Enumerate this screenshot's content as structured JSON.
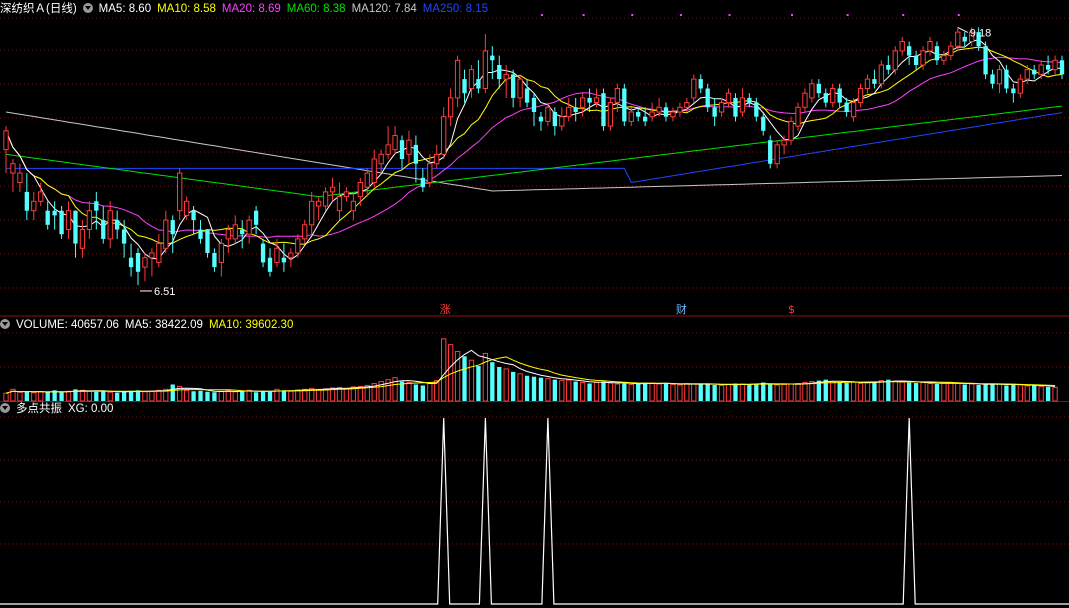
{
  "colors": {
    "up": "#ff3b3b",
    "down": "#54ffff",
    "ma5": "#ffffff",
    "ma10": "#ffff00",
    "ma20": "#ff40ff",
    "ma60": "#00e000",
    "ma120": "#c8c8c8",
    "ma250": "#2244ff",
    "grid": "#7a1010",
    "volma5": "#ffffff",
    "volma10": "#ffff00",
    "xg": "#ffffff"
  },
  "price_header": {
    "title": "深纺织Ａ(日线)",
    "ma5": "MA5: 8.60",
    "ma10": "MA10: 8.58",
    "ma20": "MA20: 8.69",
    "ma60": "MA60: 8.38",
    "ma120": "MA120: 7.84",
    "ma250": "MA250: 8.15"
  },
  "volume_header": {
    "label": "VOLUME: 40657.06",
    "ma5": "MA5: 38422.09",
    "ma10": "MA10: 39602.30"
  },
  "indicator_header": {
    "label": "多点共振",
    "xg": "XG: 0.00"
  },
  "annotations": {
    "high": "9.18",
    "low": "6.51",
    "zhang": "涨",
    "cai": "财",
    "dollar": "$"
  },
  "chart_data": {
    "type": "candlestick",
    "ylim": [
      6.35,
      9.35
    ],
    "volume_ylim": [
      0,
      70000
    ],
    "candles": [
      [
        7.95,
        8.15,
        8.2,
        7.7
      ],
      [
        7.7,
        7.8,
        7.85,
        7.5
      ],
      [
        7.6,
        7.7,
        7.8,
        7.5
      ],
      [
        7.5,
        7.3,
        7.7,
        7.2
      ],
      [
        7.3,
        7.4,
        7.5,
        7.2
      ],
      [
        7.4,
        7.5,
        7.6,
        7.35
      ],
      [
        7.3,
        7.15,
        7.4,
        7.1
      ],
      [
        7.3,
        7.25,
        7.4,
        7.1
      ],
      [
        7.3,
        7.05,
        7.35,
        7.0
      ],
      [
        7.1,
        7.3,
        7.4,
        7.0
      ],
      [
        7.3,
        6.95,
        7.3,
        6.8
      ],
      [
        6.9,
        7.1,
        7.2,
        6.8
      ],
      [
        7.1,
        7.3,
        7.4,
        7.0
      ],
      [
        7.4,
        7.3,
        7.5,
        7.1
      ],
      [
        7.2,
        7.0,
        7.35,
        6.95
      ],
      [
        7.0,
        7.3,
        7.4,
        6.9
      ],
      [
        7.2,
        7.1,
        7.3,
        7.0
      ],
      [
        7.1,
        6.95,
        7.2,
        6.8
      ],
      [
        6.8,
        6.7,
        6.95,
        6.6
      ],
      [
        6.85,
        6.65,
        6.9,
        6.51
      ],
      [
        6.7,
        6.8,
        6.85,
        6.55
      ],
      [
        6.8,
        6.85,
        6.9,
        6.6
      ],
      [
        6.75,
        6.95,
        7.05,
        6.7
      ],
      [
        6.9,
        7.2,
        7.3,
        6.85
      ],
      [
        7.2,
        7.05,
        7.25,
        6.85
      ],
      [
        7.3,
        7.7,
        7.75,
        7.2
      ],
      [
        7.25,
        7.4,
        7.45,
        7.2
      ],
      [
        7.3,
        7.2,
        7.35,
        7.05
      ],
      [
        7.1,
        7.0,
        7.2,
        6.95
      ],
      [
        7.1,
        6.85,
        7.1,
        6.8
      ],
      [
        6.85,
        6.7,
        6.9,
        6.65
      ],
      [
        6.75,
        6.95,
        7.0,
        6.6
      ],
      [
        7.0,
        7.1,
        7.15,
        6.85
      ],
      [
        7.0,
        7.15,
        7.25,
        6.95
      ],
      [
        7.1,
        7.05,
        7.2,
        6.9
      ],
      [
        7.05,
        7.2,
        7.25,
        6.95
      ],
      [
        7.3,
        7.15,
        7.35,
        7.05
      ],
      [
        6.95,
        6.75,
        7.0,
        6.7
      ],
      [
        6.8,
        6.65,
        6.9,
        6.6
      ],
      [
        6.75,
        6.9,
        7.0,
        6.7
      ],
      [
        6.8,
        6.75,
        6.95,
        6.65
      ],
      [
        6.8,
        6.85,
        6.9,
        6.7
      ],
      [
        6.85,
        7.0,
        7.05,
        6.8
      ],
      [
        7.0,
        7.15,
        7.2,
        6.95
      ],
      [
        7.15,
        7.4,
        7.5,
        7.05
      ],
      [
        7.35,
        7.4,
        7.45,
        7.2
      ],
      [
        7.35,
        7.5,
        7.55,
        7.3
      ],
      [
        7.5,
        7.55,
        7.65,
        7.4
      ],
      [
        7.3,
        7.45,
        7.6,
        7.2
      ],
      [
        7.45,
        7.5,
        7.55,
        7.4
      ],
      [
        7.3,
        7.4,
        7.5,
        7.2
      ],
      [
        7.45,
        7.6,
        7.65,
        7.35
      ],
      [
        7.55,
        7.7,
        7.75,
        7.45
      ],
      [
        7.6,
        7.85,
        7.95,
        7.55
      ],
      [
        7.8,
        7.9,
        7.95,
        7.7
      ],
      [
        7.9,
        8.0,
        8.2,
        7.85
      ],
      [
        7.95,
        8.1,
        8.2,
        7.9
      ],
      [
        8.05,
        7.85,
        8.1,
        7.75
      ],
      [
        7.9,
        8.05,
        8.15,
        7.8
      ],
      [
        8.0,
        7.8,
        8.1,
        7.6
      ],
      [
        7.65,
        7.55,
        7.75,
        7.5
      ],
      [
        7.6,
        7.8,
        7.9,
        7.55
      ],
      [
        7.8,
        7.9,
        8.0,
        7.75
      ],
      [
        7.9,
        8.3,
        8.4,
        7.85
      ],
      [
        8.3,
        8.5,
        8.6,
        8.2
      ],
      [
        8.5,
        8.9,
        8.95,
        8.4
      ],
      [
        8.7,
        8.55,
        8.8,
        8.45
      ],
      [
        8.6,
        8.8,
        8.85,
        8.5
      ],
      [
        8.7,
        8.6,
        8.9,
        8.55
      ],
      [
        8.6,
        9.0,
        9.18,
        8.55
      ],
      [
        8.95,
        8.9,
        9.05,
        8.7
      ],
      [
        8.85,
        8.7,
        8.95,
        8.6
      ],
      [
        8.7,
        8.75,
        8.85,
        8.5
      ],
      [
        8.75,
        8.5,
        8.8,
        8.4
      ],
      [
        8.5,
        8.7,
        8.75,
        8.4
      ],
      [
        8.6,
        8.45,
        8.7,
        8.4
      ],
      [
        8.5,
        8.35,
        8.55,
        8.2
      ],
      [
        8.3,
        8.25,
        8.35,
        8.15
      ],
      [
        8.25,
        8.4,
        8.45,
        8.2
      ],
      [
        8.35,
        8.2,
        8.4,
        8.1
      ],
      [
        8.2,
        8.3,
        8.4,
        8.15
      ],
      [
        8.3,
        8.4,
        8.5,
        8.25
      ],
      [
        8.4,
        8.35,
        8.5,
        8.25
      ],
      [
        8.4,
        8.5,
        8.55,
        8.3
      ],
      [
        8.5,
        8.45,
        8.6,
        8.35
      ],
      [
        8.45,
        8.5,
        8.6,
        8.4
      ],
      [
        8.55,
        8.2,
        8.6,
        8.15
      ],
      [
        8.2,
        8.45,
        8.5,
        8.15
      ],
      [
        8.45,
        8.6,
        8.65,
        8.35
      ],
      [
        8.6,
        8.25,
        8.65,
        8.2
      ],
      [
        8.25,
        8.35,
        8.4,
        8.2
      ],
      [
        8.35,
        8.3,
        8.4,
        8.25
      ],
      [
        8.3,
        8.25,
        8.4,
        8.2
      ],
      [
        8.3,
        8.35,
        8.45,
        8.25
      ],
      [
        8.35,
        8.4,
        8.5,
        8.3
      ],
      [
        8.4,
        8.3,
        8.45,
        8.25
      ],
      [
        8.3,
        8.35,
        8.4,
        8.25
      ],
      [
        8.35,
        8.4,
        8.45,
        8.3
      ],
      [
        8.4,
        8.45,
        8.5,
        8.35
      ],
      [
        8.5,
        8.7,
        8.75,
        8.45
      ],
      [
        8.7,
        8.6,
        8.75,
        8.55
      ],
      [
        8.6,
        8.4,
        8.65,
        8.35
      ],
      [
        8.4,
        8.3,
        8.5,
        8.2
      ],
      [
        8.35,
        8.45,
        8.5,
        8.3
      ],
      [
        8.45,
        8.55,
        8.6,
        8.4
      ],
      [
        8.5,
        8.3,
        8.55,
        8.25
      ],
      [
        8.35,
        8.5,
        8.6,
        8.3
      ],
      [
        8.5,
        8.45,
        8.55,
        8.4
      ],
      [
        8.45,
        8.3,
        8.5,
        8.25
      ],
      [
        8.3,
        8.15,
        8.35,
        8.1
      ],
      [
        8.05,
        7.8,
        8.1,
        7.75
      ],
      [
        7.8,
        8.0,
        8.05,
        7.75
      ],
      [
        8.0,
        8.05,
        8.1,
        7.9
      ],
      [
        8.05,
        8.25,
        8.3,
        8.0
      ],
      [
        8.2,
        8.4,
        8.45,
        8.15
      ],
      [
        8.4,
        8.55,
        8.6,
        8.35
      ],
      [
        8.5,
        8.65,
        8.7,
        8.45
      ],
      [
        8.65,
        8.55,
        8.7,
        8.5
      ],
      [
        8.55,
        8.45,
        8.6,
        8.4
      ],
      [
        8.45,
        8.6,
        8.65,
        8.4
      ],
      [
        8.6,
        8.45,
        8.65,
        8.4
      ],
      [
        8.45,
        8.35,
        8.5,
        8.3
      ],
      [
        8.3,
        8.45,
        8.5,
        8.25
      ],
      [
        8.45,
        8.6,
        8.65,
        8.4
      ],
      [
        8.6,
        8.7,
        8.75,
        8.55
      ],
      [
        8.7,
        8.65,
        8.8,
        8.6
      ],
      [
        8.65,
        8.85,
        8.9,
        8.6
      ],
      [
        8.85,
        8.8,
        8.95,
        8.75
      ],
      [
        8.8,
        9.0,
        9.05,
        8.75
      ],
      [
        9.0,
        9.1,
        9.15,
        8.95
      ],
      [
        9.05,
        8.95,
        9.1,
        8.85
      ],
      [
        8.95,
        8.85,
        9.0,
        8.8
      ],
      [
        8.85,
        9.0,
        9.05,
        8.8
      ],
      [
        9.0,
        9.1,
        9.15,
        8.95
      ],
      [
        9.05,
        8.9,
        9.1,
        8.85
      ],
      [
        8.9,
        8.95,
        9.0,
        8.85
      ],
      [
        8.95,
        9.05,
        9.1,
        8.9
      ],
      [
        9.05,
        9.2,
        9.25,
        9.0
      ],
      [
        9.15,
        9.1,
        9.2,
        9.05
      ],
      [
        9.1,
        9.2,
        9.25,
        9.05
      ],
      [
        9.2,
        9.05,
        9.25,
        9.0
      ],
      [
        9.05,
        8.75,
        9.1,
        8.7
      ],
      [
        8.75,
        8.65,
        8.8,
        8.6
      ],
      [
        8.65,
        8.8,
        8.85,
        8.55
      ],
      [
        8.8,
        8.6,
        8.85,
        8.55
      ],
      [
        8.6,
        8.55,
        8.65,
        8.45
      ],
      [
        8.55,
        8.7,
        8.75,
        8.5
      ],
      [
        8.7,
        8.8,
        8.85,
        8.65
      ],
      [
        8.8,
        8.75,
        8.85,
        8.7
      ],
      [
        8.75,
        8.85,
        8.9,
        8.7
      ],
      [
        8.85,
        8.8,
        8.95,
        8.75
      ],
      [
        8.8,
        8.9,
        8.95,
        8.75
      ],
      [
        8.9,
        8.75,
        8.95,
        8.7
      ]
    ],
    "volume": [
      8000,
      12000,
      9000,
      10000,
      8500,
      9500,
      9000,
      11000,
      9000,
      10000,
      12000,
      11000,
      10000,
      9500,
      10500,
      9000,
      8500,
      10000,
      10500,
      11000,
      9500,
      10000,
      11000,
      12000,
      17000,
      15000,
      11000,
      10000,
      10500,
      9500,
      9000,
      10000,
      11000,
      9500,
      10500,
      11000,
      9000,
      10000,
      9500,
      12000,
      11000,
      10000,
      11500,
      12000,
      13000,
      12000,
      12500,
      13500,
      14000,
      13000,
      14500,
      15000,
      16000,
      18000,
      20000,
      22000,
      24000,
      20000,
      19000,
      17000,
      16000,
      18000,
      21000,
      64000,
      58000,
      51000,
      46000,
      42000,
      36000,
      49000,
      40000,
      35000,
      33000,
      30000,
      28000,
      26000,
      25000,
      24000,
      23000,
      22000,
      21000,
      21500,
      20000,
      19000,
      18000,
      19000,
      20000,
      18500,
      17500,
      18000,
      17000,
      18000,
      19000,
      18500,
      17500,
      18000,
      17000,
      16500,
      18000,
      17500,
      18000,
      17000,
      16500,
      16000,
      17000,
      18000,
      17500,
      17000,
      18000,
      19000,
      17500,
      16500,
      17000,
      17500,
      18000,
      19000,
      20000,
      21000,
      22000,
      20000,
      19000,
      18500,
      19500,
      18000,
      19000,
      20000,
      21000,
      22000,
      20500,
      19500,
      19000,
      18500,
      19000,
      18000,
      17500,
      18500,
      19000,
      18000,
      17000,
      17500,
      16500,
      17000,
      18000,
      17500,
      16000,
      17000,
      16500,
      15500,
      16000,
      15000,
      14500,
      14000
    ]
  }
}
